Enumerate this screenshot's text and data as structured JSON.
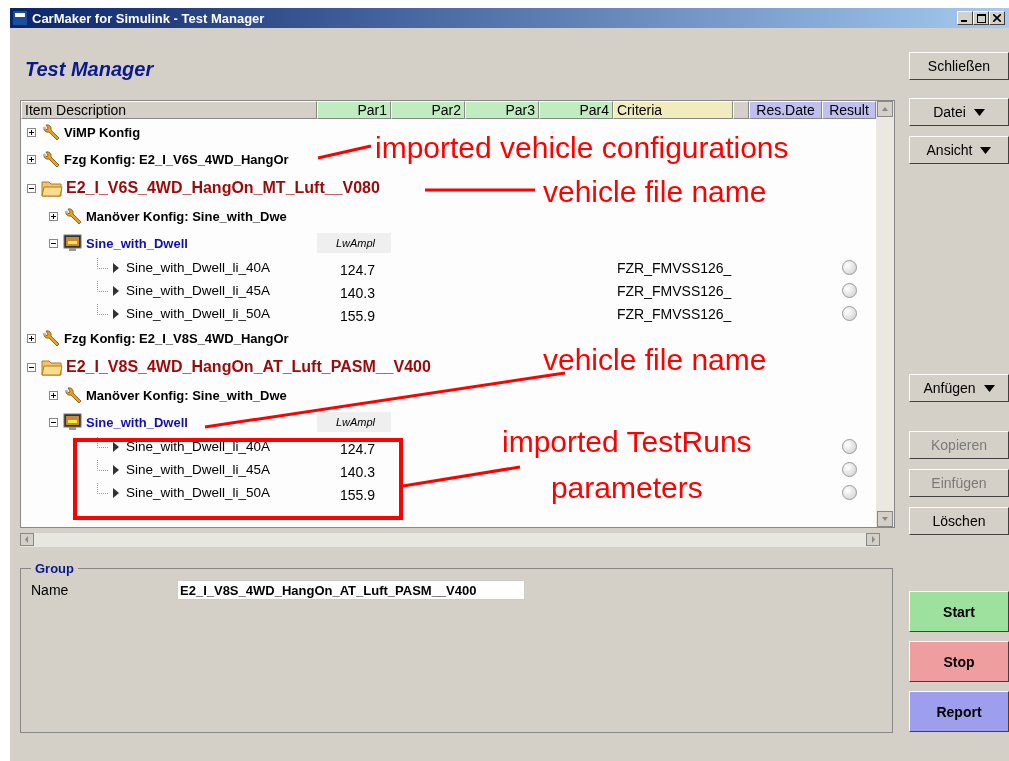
{
  "window": {
    "title": "CarMaker for Simulink - Test Manager"
  },
  "heading": "Test Manager",
  "table": {
    "columns": [
      {
        "label": "Item Description",
        "kind": "name"
      },
      {
        "label": "Par1",
        "kind": "param"
      },
      {
        "label": "Par2",
        "kind": "param"
      },
      {
        "label": "Par3",
        "kind": "param"
      },
      {
        "label": "Par4",
        "kind": "param"
      },
      {
        "label": "Criteria",
        "kind": "criteria"
      },
      {
        "kind": "blank"
      },
      {
        "label": "Res.Date",
        "kind": "result"
      },
      {
        "label": "Result",
        "kind": "result"
      }
    ],
    "tree": [
      {
        "kind": "config",
        "label": "ViMP Konfig",
        "expanded": false
      },
      {
        "kind": "config",
        "label": "Fzg Konfig: E2_I_V6S_4WD_HangOr",
        "expanded": false
      },
      {
        "kind": "folder",
        "label": "E2_I_V6S_4WD_HangOn_MT_Luft__V080",
        "expanded": true,
        "children": [
          {
            "kind": "config",
            "label": "Manöver Konfig: Sine_with_Dwe",
            "expanded": false
          },
          {
            "kind": "maneuver",
            "label": "Sine_with_Dwell",
            "expanded": true,
            "param": "LwAmpl",
            "children": [
              {
                "kind": "testrun",
                "label": "Sine_with_Dwell_li_40A",
                "par1": "124.7",
                "criteria": "FZR_FMVSS126_"
              },
              {
                "kind": "testrun",
                "label": "Sine_with_Dwell_li_45A",
                "par1": "140.3",
                "criteria": "FZR_FMVSS126_"
              },
              {
                "kind": "testrun",
                "label": "Sine_with_Dwell_li_50A",
                "par1": "155.9",
                "criteria": "FZR_FMVSS126_"
              }
            ]
          }
        ]
      },
      {
        "kind": "config",
        "label": "Fzg Konfig: E2_I_V8S_4WD_HangOr",
        "expanded": false
      },
      {
        "kind": "folder",
        "label": "E2_I_V8S_4WD_HangOn_AT_Luft_PASM__V400",
        "expanded": true,
        "children": [
          {
            "kind": "config",
            "label": "Manöver Konfig: Sine_with_Dwe",
            "expanded": false
          },
          {
            "kind": "maneuver",
            "label": "Sine_with_Dwell",
            "expanded": true,
            "param": "LwAmpl",
            "children": [
              {
                "kind": "testrun",
                "label": "Sine_with_Dwell_li_40A",
                "par1": "124.7"
              },
              {
                "kind": "testrun",
                "label": "Sine_with_Dwell_li_45A",
                "par1": "140.3"
              },
              {
                "kind": "testrun",
                "label": "Sine_with_Dwell_li_50A",
                "par1": "155.9"
              }
            ]
          }
        ]
      }
    ]
  },
  "annotations": [
    {
      "lines": [
        "imported vehicle configurations"
      ]
    },
    {
      "lines": [
        "vehicle file name"
      ]
    },
    {
      "lines": [
        "vehicle file name"
      ]
    },
    {
      "lines": [
        "imported TestRuns",
        "parameters"
      ]
    }
  ],
  "group": {
    "title": "Group",
    "name_label": "Name",
    "name_value": "E2_I_V8S_4WD_HangOn_AT_Luft_PASM__V400"
  },
  "side_buttons": [
    [
      {
        "label": "Schließen",
        "menu": false,
        "disabled": false
      }
    ],
    [
      {
        "label": "Datei",
        "menu": true,
        "disabled": false
      },
      {
        "label": "Ansicht",
        "menu": true,
        "disabled": false
      }
    ],
    [
      {
        "label": "Anfügen",
        "menu": true,
        "disabled": false
      }
    ],
    [
      {
        "label": "Kopieren",
        "menu": false,
        "disabled": true
      },
      {
        "label": "Einfügen",
        "menu": false,
        "disabled": true
      },
      {
        "label": "Löschen",
        "menu": false,
        "disabled": false
      }
    ]
  ],
  "run_buttons": [
    {
      "label": "Start",
      "color": "#9ee09e"
    },
    {
      "label": "Stop",
      "color": "#ee9e9e"
    },
    {
      "label": "Report",
      "color": "#9e9eee"
    }
  ]
}
